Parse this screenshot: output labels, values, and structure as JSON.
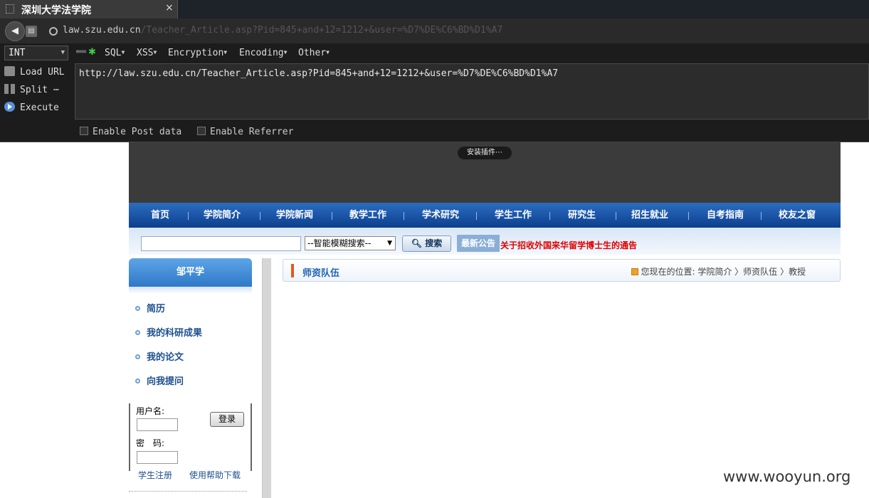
{
  "browser": {
    "tab_title": "深圳大学法学院",
    "tab_close": "×",
    "back_glyph": "◀",
    "url_host": "law.szu.edu.cn",
    "url_rest": "/Teacher_Article.asp?Pid=845+and+12=1212+&user=%D7%DE%C6%BD%D1%A7"
  },
  "hackbar": {
    "type_select": "INT",
    "plus_glyph": "➖",
    "star_glyph": "✱",
    "menus": [
      "SQL",
      "XSS",
      "Encryption",
      "Encoding",
      "Other"
    ],
    "actions": {
      "load": "Load URL",
      "split": "Split ⋯",
      "execute": "Execute"
    },
    "textarea_value": "http://law.szu.edu.cn/Teacher_Article.asp?Pid=845+and+12=1212+&user=%D7%DE%C6%BD%D1%A7",
    "enable_post": "Enable Post data",
    "enable_referrer": "Enable Referrer"
  },
  "site": {
    "plugin_pill": "安装插件⋯",
    "nav": [
      "首页",
      "学院简介",
      "学院新闻",
      "教学工作",
      "学术研究",
      "学生工作",
      "研究生",
      "招生就业",
      "自考指南",
      "校友之窗"
    ],
    "search": {
      "select": "--智能模糊搜索--",
      "button": "搜索",
      "notice_tag": "最新公告",
      "notice_text": "关于招收外国来华留学博士生的通告"
    },
    "teacher_name": "邹平学",
    "side_links": [
      "简历",
      "我的科研成果",
      "我的论文",
      "向我提问"
    ],
    "login": {
      "username_label": "用户名:",
      "password_label": "密　码:",
      "submit": "登录",
      "register": "学生注册",
      "help": "使用帮助下载"
    },
    "breadcrumb": {
      "title": "师资队伍",
      "path": "您现在的位置: 学院简介 〉师资队伍 〉教授"
    }
  },
  "watermark": "www.wooyun.org"
}
